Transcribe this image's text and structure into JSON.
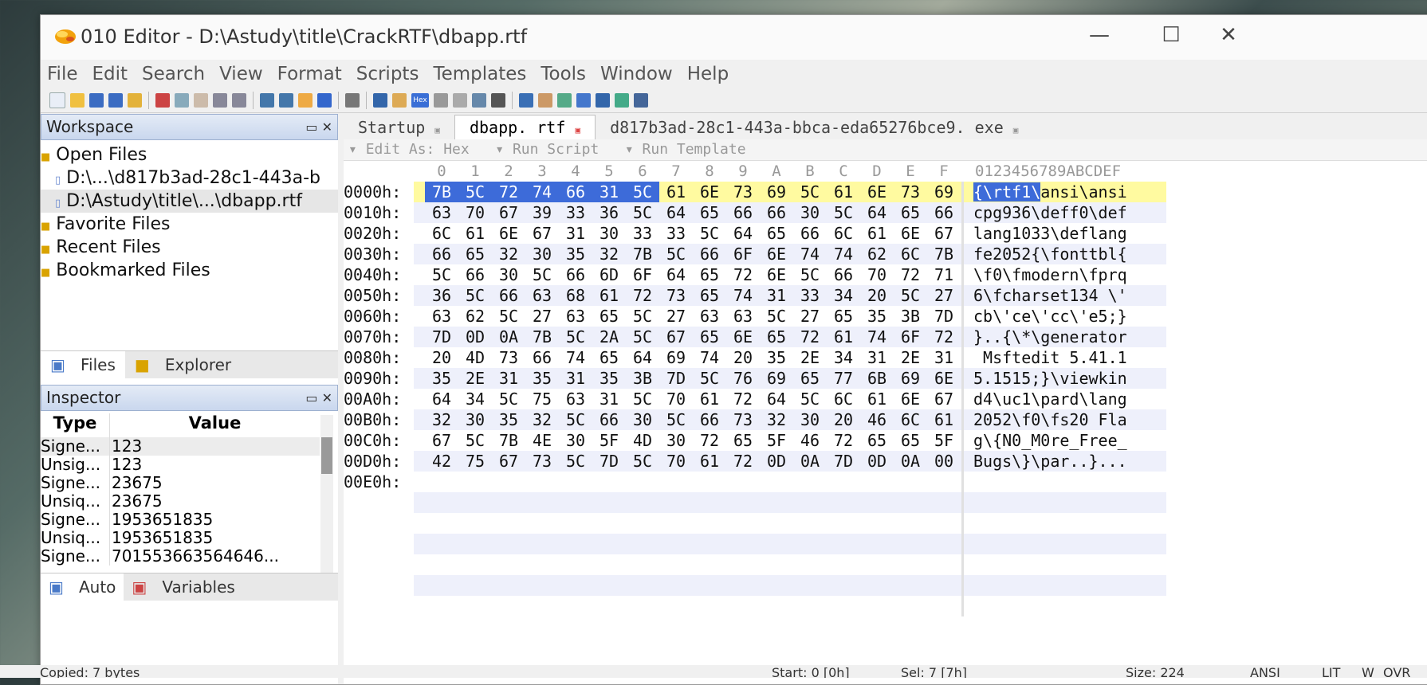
{
  "window": {
    "title": "010 Editor - D:\\Astudy\\title\\CrackRTF\\dbapp.rtf"
  },
  "menu": [
    "File",
    "Edit",
    "Search",
    "View",
    "Format",
    "Scripts",
    "Templates",
    "Tools",
    "Window",
    "Help"
  ],
  "workspace": {
    "title": "Workspace",
    "open_files": "Open Files",
    "file1": "D:\\...\\d817b3ad-28c1-443a-b",
    "file2": "D:\\Astudy\\title\\...\\dbapp.rtf",
    "favorite": "Favorite Files",
    "recent": "Recent Files",
    "bookmarked": "Bookmarked Files",
    "tab_files": "Files",
    "tab_explorer": "Explorer"
  },
  "inspector": {
    "title": "Inspector",
    "col_type": "Type",
    "col_value": "Value",
    "rows": [
      {
        "type": "Signe...",
        "value": "123"
      },
      {
        "type": "Unsig...",
        "value": "123"
      },
      {
        "type": "Signe...",
        "value": "23675"
      },
      {
        "type": "Unsiq...",
        "value": "23675"
      },
      {
        "type": "Signe...",
        "value": "1953651835"
      },
      {
        "type": "Unsiq...",
        "value": "1953651835"
      },
      {
        "type": "Signe...",
        "value": "701553663564646..."
      }
    ],
    "tab_auto": "Auto",
    "tab_variables": "Variables"
  },
  "tabs": [
    "Startup",
    "dbapp. rtf",
    "d817b3ad-28c1-443a-bbca-eda65276bce9. exe"
  ],
  "editbar": {
    "edit_as": "Edit As: Hex",
    "run_script": "Run Script",
    "run_template": "Run Template"
  },
  "hex_header": {
    "cols": [
      "0",
      "1",
      "2",
      "3",
      "4",
      "5",
      "6",
      "7",
      "8",
      "9",
      "A",
      "B",
      "C",
      "D",
      "E",
      "F"
    ],
    "ascii": "0123456789ABCDEF"
  },
  "rows": [
    {
      "addr": "0000h:",
      "bytes": [
        "7B",
        "5C",
        "72",
        "74",
        "66",
        "31",
        "5C",
        "61",
        "6E",
        "73",
        "69",
        "5C",
        "61",
        "6E",
        "73",
        "69"
      ],
      "ascii": "{\\rtf1\\ansi\\ansi"
    },
    {
      "addr": "0010h:",
      "bytes": [
        "63",
        "70",
        "67",
        "39",
        "33",
        "36",
        "5C",
        "64",
        "65",
        "66",
        "66",
        "30",
        "5C",
        "64",
        "65",
        "66"
      ],
      "ascii": "cpg936\\deff0\\def"
    },
    {
      "addr": "0020h:",
      "bytes": [
        "6C",
        "61",
        "6E",
        "67",
        "31",
        "30",
        "33",
        "33",
        "5C",
        "64",
        "65",
        "66",
        "6C",
        "61",
        "6E",
        "67"
      ],
      "ascii": "lang1033\\deflang"
    },
    {
      "addr": "0030h:",
      "bytes": [
        "66",
        "65",
        "32",
        "30",
        "35",
        "32",
        "7B",
        "5C",
        "66",
        "6F",
        "6E",
        "74",
        "74",
        "62",
        "6C",
        "7B"
      ],
      "ascii": "fe2052{\\fonttbl{"
    },
    {
      "addr": "0040h:",
      "bytes": [
        "5C",
        "66",
        "30",
        "5C",
        "66",
        "6D",
        "6F",
        "64",
        "65",
        "72",
        "6E",
        "5C",
        "66",
        "70",
        "72",
        "71"
      ],
      "ascii": "\\f0\\fmodern\\fprq"
    },
    {
      "addr": "0050h:",
      "bytes": [
        "36",
        "5C",
        "66",
        "63",
        "68",
        "61",
        "72",
        "73",
        "65",
        "74",
        "31",
        "33",
        "34",
        "20",
        "5C",
        "27"
      ],
      "ascii": "6\\fcharset134 \\'"
    },
    {
      "addr": "0060h:",
      "bytes": [
        "63",
        "62",
        "5C",
        "27",
        "63",
        "65",
        "5C",
        "27",
        "63",
        "63",
        "5C",
        "27",
        "65",
        "35",
        "3B",
        "7D"
      ],
      "ascii": "cb\\'ce\\'cc\\'e5;}"
    },
    {
      "addr": "0070h:",
      "bytes": [
        "7D",
        "0D",
        "0A",
        "7B",
        "5C",
        "2A",
        "5C",
        "67",
        "65",
        "6E",
        "65",
        "72",
        "61",
        "74",
        "6F",
        "72"
      ],
      "ascii": "}..{\\*\\generator"
    },
    {
      "addr": "0080h:",
      "bytes": [
        "20",
        "4D",
        "73",
        "66",
        "74",
        "65",
        "64",
        "69",
        "74",
        "20",
        "35",
        "2E",
        "34",
        "31",
        "2E",
        "31"
      ],
      "ascii": " Msftedit 5.41.1"
    },
    {
      "addr": "0090h:",
      "bytes": [
        "35",
        "2E",
        "31",
        "35",
        "31",
        "35",
        "3B",
        "7D",
        "5C",
        "76",
        "69",
        "65",
        "77",
        "6B",
        "69",
        "6E"
      ],
      "ascii": "5.1515;}\\viewkin"
    },
    {
      "addr": "00A0h:",
      "bytes": [
        "64",
        "34",
        "5C",
        "75",
        "63",
        "31",
        "5C",
        "70",
        "61",
        "72",
        "64",
        "5C",
        "6C",
        "61",
        "6E",
        "67"
      ],
      "ascii": "d4\\uc1\\pard\\lang"
    },
    {
      "addr": "00B0h:",
      "bytes": [
        "32",
        "30",
        "35",
        "32",
        "5C",
        "66",
        "30",
        "5C",
        "66",
        "73",
        "32",
        "30",
        "20",
        "46",
        "6C",
        "61"
      ],
      "ascii": "2052\\f0\\fs20 Fla"
    },
    {
      "addr": "00C0h:",
      "bytes": [
        "67",
        "5C",
        "7B",
        "4E",
        "30",
        "5F",
        "4D",
        "30",
        "72",
        "65",
        "5F",
        "46",
        "72",
        "65",
        "65",
        "5F"
      ],
      "ascii": "g\\{N0_M0re_Free_"
    },
    {
      "addr": "00D0h:",
      "bytes": [
        "42",
        "75",
        "67",
        "73",
        "5C",
        "7D",
        "5C",
        "70",
        "61",
        "72",
        "0D",
        "0A",
        "7D",
        "0D",
        "0A",
        "00"
      ],
      "ascii": "Bugs\\}\\par..}..."
    },
    {
      "addr": "00E0h:",
      "bytes": [],
      "ascii": ""
    }
  ],
  "status": {
    "copied": "Copied: 7 bytes",
    "start": "Start: 0 [0h]",
    "sel": "Sel: 7 [7h]",
    "size": "Size: 224",
    "enc": "ANSI",
    "lit": "LIT",
    "w": "W",
    "ovr": "OVR"
  }
}
